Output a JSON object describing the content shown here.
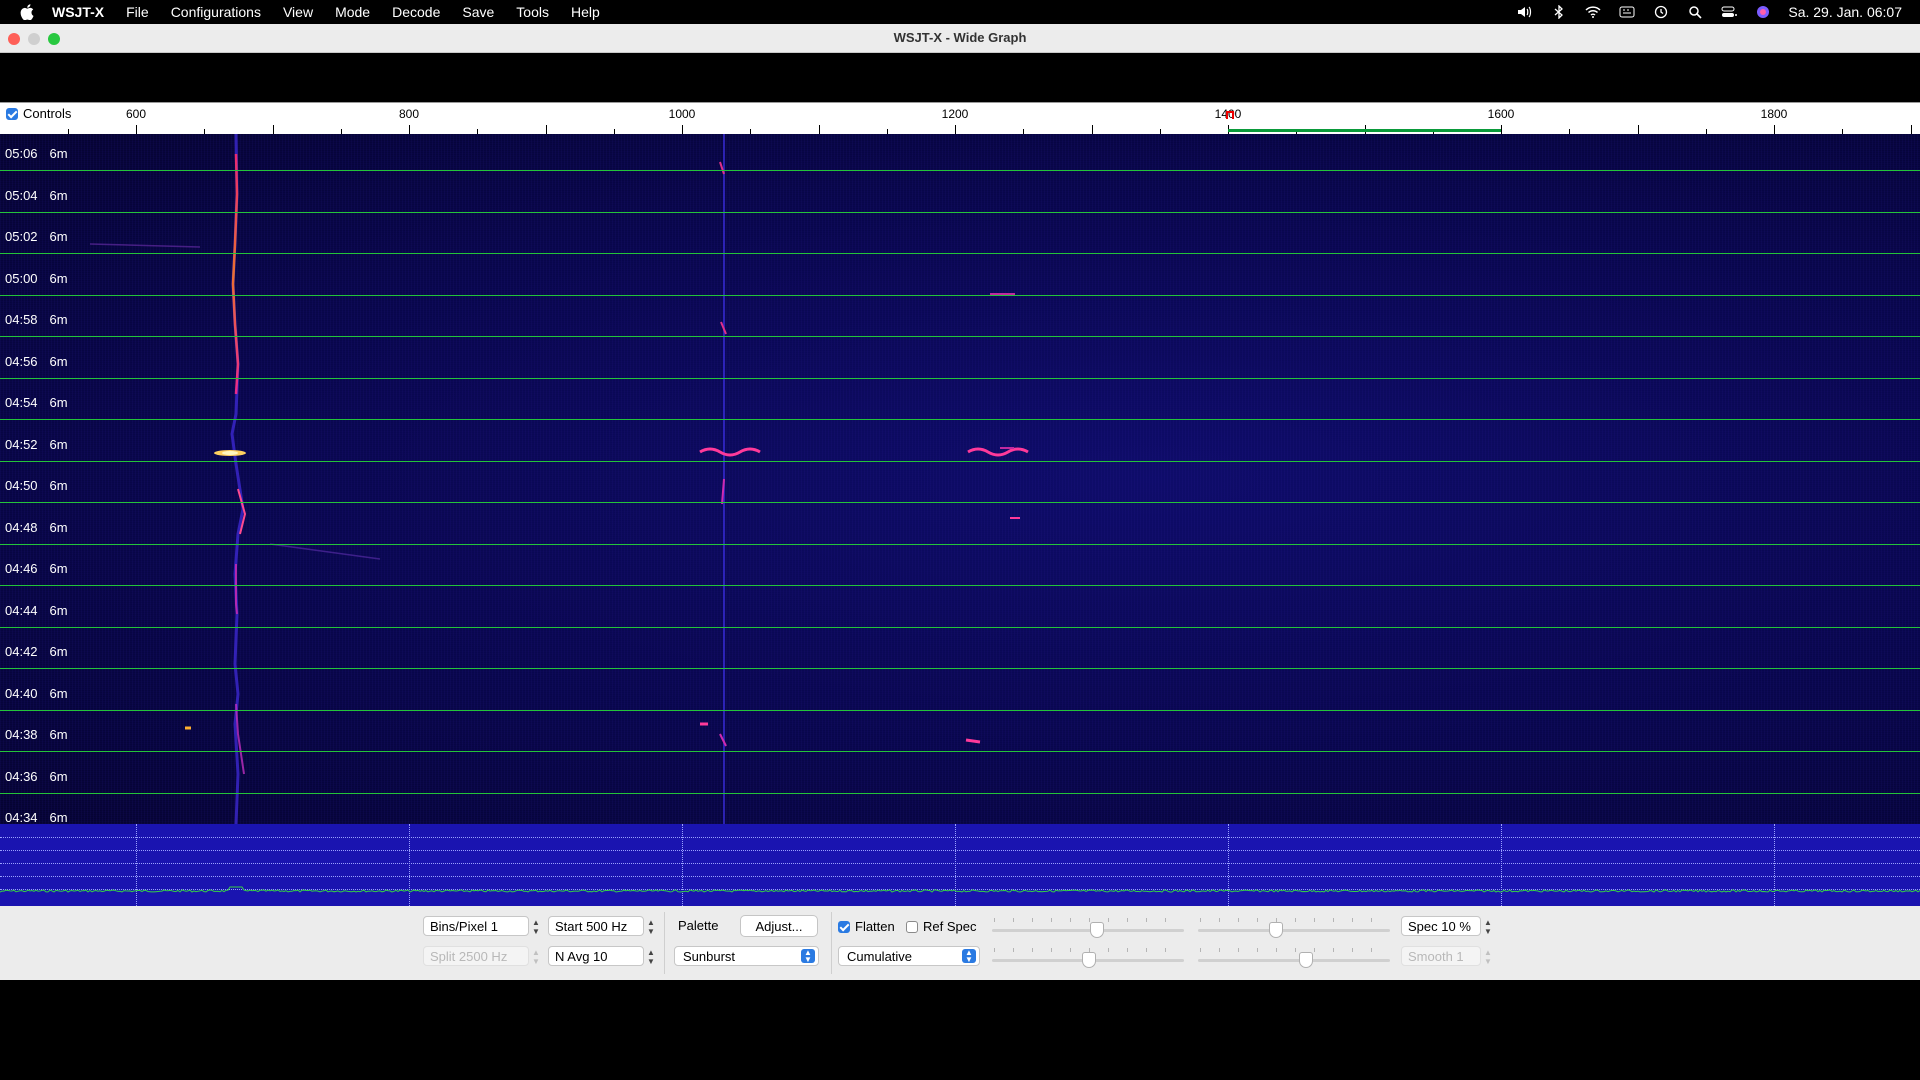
{
  "menubar": {
    "app_name": "WSJT-X",
    "items": [
      "File",
      "Configurations",
      "View",
      "Mode",
      "Decode",
      "Save",
      "Tools",
      "Help"
    ],
    "datetime": "Sa. 29. Jan.  06:07",
    "status_icons": [
      "volume-icon",
      "bluetooth-icon",
      "wifi-icon",
      "keyboard-icon",
      "time-machine-icon",
      "search-icon",
      "control-center-icon",
      "siri-icon"
    ]
  },
  "window": {
    "title": "WSJT-X - Wide Graph"
  },
  "ruler": {
    "controls_label": "Controls",
    "controls_checked": true,
    "freq_labels": [
      "600",
      "800",
      "1000",
      "1200",
      "1400",
      "1600",
      "1800"
    ]
  },
  "waterfall": {
    "rows": [
      {
        "time": "05:06",
        "band": "6m"
      },
      {
        "time": "05:04",
        "band": "6m"
      },
      {
        "time": "05:02",
        "band": "6m"
      },
      {
        "time": "05:00",
        "band": "6m"
      },
      {
        "time": "04:58",
        "band": "6m"
      },
      {
        "time": "04:56",
        "band": "6m"
      },
      {
        "time": "04:54",
        "band": "6m"
      },
      {
        "time": "04:52",
        "band": "6m"
      },
      {
        "time": "04:50",
        "band": "6m"
      },
      {
        "time": "04:48",
        "band": "6m"
      },
      {
        "time": "04:46",
        "band": "6m"
      },
      {
        "time": "04:44",
        "band": "6m"
      },
      {
        "time": "04:42",
        "band": "6m"
      },
      {
        "time": "04:40",
        "band": "6m"
      },
      {
        "time": "04:38",
        "band": "6m"
      },
      {
        "time": "04:36",
        "band": "6m"
      },
      {
        "time": "04:34",
        "band": "6m"
      }
    ],
    "colors": {
      "timeline": "#23c43a",
      "background": "#08064a",
      "spectrum_bg": "#1a14b0"
    }
  },
  "controls": {
    "bins_pixel": "Bins/Pixel  1",
    "start_freq": "Start 500 Hz",
    "split": "Split  2500  Hz",
    "n_avg": "N Avg 10",
    "palette_label": "Palette",
    "adjust_button": "Adjust...",
    "palette_value": "Sunburst",
    "flatten_label": "Flatten",
    "flatten_checked": true,
    "ref_spec_label": "Ref Spec",
    "ref_spec_checked": false,
    "spectrum_mode": "Cumulative",
    "spec_percent": "Spec 10 %",
    "smooth": "Smooth  1"
  }
}
